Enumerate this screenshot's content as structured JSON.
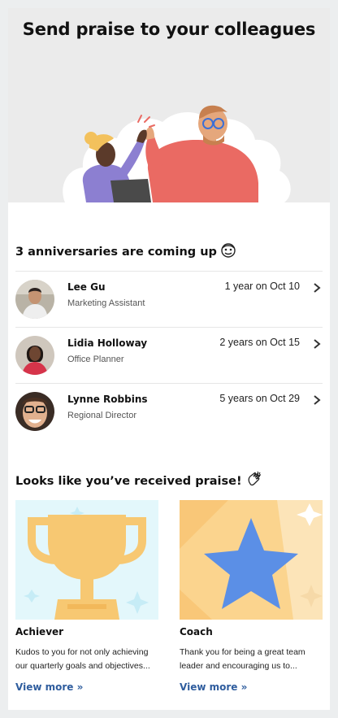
{
  "hero": {
    "title": "Send praise to your colleagues"
  },
  "anniversaries": {
    "heading": "3 anniversaries are coming up",
    "heading_icon": "face-with-party-emoji",
    "items": [
      {
        "name": "Lee Gu",
        "role": "Marketing Assistant",
        "date": "1 year on Oct 10"
      },
      {
        "name": "Lidia Holloway",
        "role": "Office Planner",
        "date": "2 years on Oct 15"
      },
      {
        "name": "Lynne Robbins",
        "role": "Regional Director",
        "date": "5 years on Oct 29"
      }
    ]
  },
  "praise": {
    "heading": "Looks like you’ve received praise!",
    "heading_icon": "clapping-hands-emoji",
    "cards": [
      {
        "title": "Achiever",
        "description": "Kudos to you for not only achieving our quarterly goals and objectives...",
        "link": "View more »",
        "icon": "trophy"
      },
      {
        "title": "Coach",
        "description": "Thank you for being a great team leader and encouraging us to...",
        "link": "View more »",
        "icon": "star"
      }
    ]
  },
  "colors": {
    "link": "#2f5d9e",
    "hero_bg": "#ebebeb",
    "trophy_bg": "#e3f7fb",
    "trophy": "#f7c872",
    "star": "#5b8fe6"
  }
}
